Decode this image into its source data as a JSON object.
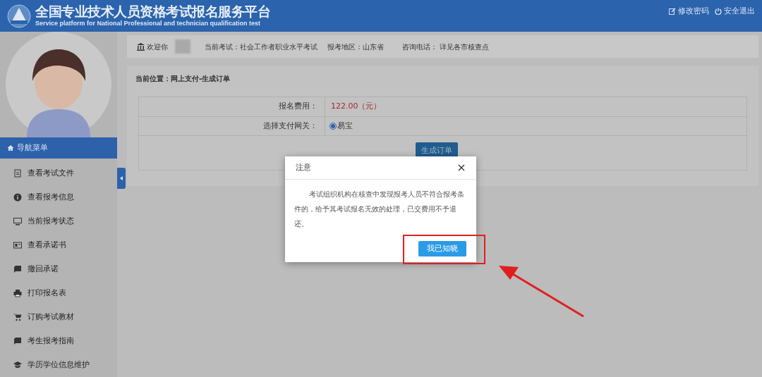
{
  "header": {
    "title": "全国专业技术人员资格考试报名服务平台",
    "subtitle": "Service platform for National Professional and technician qualification test",
    "links": [
      {
        "label": "修改密码"
      },
      {
        "label": "安全退出"
      }
    ]
  },
  "welcome_bar": {
    "greeting": "欢迎你",
    "exam": "当前考试：社会工作者职业水平考试",
    "region": "报考地区：山东省",
    "phone": "咨询电话： 详见各市核查点"
  },
  "sidebar": {
    "title": "导航菜单",
    "items": [
      {
        "label": "查看考试文件"
      },
      {
        "label": "查看报考信息"
      },
      {
        "label": "当前报考状态"
      },
      {
        "label": "查看承诺书"
      },
      {
        "label": "撤回承诺"
      },
      {
        "label": "打印报名表"
      },
      {
        "label": "订购考试教材"
      },
      {
        "label": "考生报考指南"
      },
      {
        "label": "学历学位信息维护"
      }
    ]
  },
  "breadcrumb": "当前位置：网上支付-生成订单",
  "form": {
    "fee_label": "报名费用：",
    "fee_value": "122.00（元）",
    "gateway_label": "选择支付网关：",
    "gateway_options": [
      {
        "label": "易宝",
        "selected": true
      }
    ],
    "submit": "生成订单"
  },
  "dialog": {
    "title": "注意",
    "message": "考试组织机构在核查中发现报考人员不符合报考条件的，给予其考试报名无效的处理，已交费用不予退还。",
    "confirm": "我已知晓"
  }
}
